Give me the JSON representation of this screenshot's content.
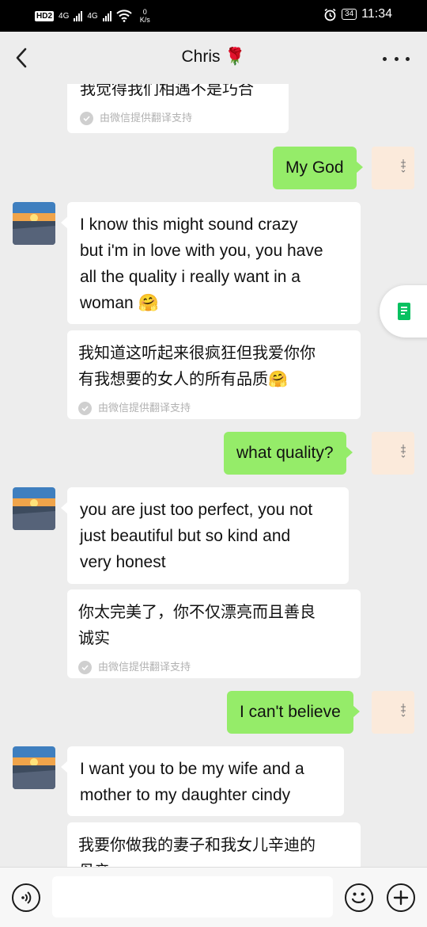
{
  "status_bar": {
    "hd": "HD",
    "hd_sub": "2",
    "net1": "4G",
    "net2": "4G",
    "speed_value": "0",
    "speed_unit": "K/s",
    "battery": "34",
    "time": "11:34"
  },
  "header": {
    "title": "Chris 🌹"
  },
  "messages": [
    {
      "side": "in",
      "text": "我觉得我们相遇不是巧合",
      "translated": true,
      "note": "由微信提供翻译支持"
    },
    {
      "side": "out",
      "text": "My God"
    },
    {
      "side": "in",
      "text": "I know this might sound crazy\nbut i'm in love with you, you  have\nall the quality i really want  in a\nwoman 🤗"
    },
    {
      "side": "in",
      "text": "我知道这听起来很疯狂但我爱你你\n有我想要的女人的所有品质🤗",
      "translated": true,
      "note": "由微信提供翻译支持"
    },
    {
      "side": "out",
      "text": "what quality?"
    },
    {
      "side": "in",
      "text": "you are just too perfect, you not\njust beautiful but so  kind and\nvery honest"
    },
    {
      "side": "in",
      "text": "你太完美了，你不仅漂亮而且善良\n诚实",
      "translated": true,
      "note": "由微信提供翻译支持"
    },
    {
      "side": "out",
      "text": "I can't believe"
    },
    {
      "side": "in",
      "text": "I want you to be my wife and  a\nmother to my daughter cindy"
    },
    {
      "side": "in",
      "text": "我要你做我的妻子和我女儿辛迪的\n母亲",
      "translated": true
    }
  ],
  "input": {
    "value": "",
    "placeholder": ""
  },
  "colors": {
    "background": "#ededed",
    "outgoing_bubble": "#95ec69",
    "incoming_bubble": "#ffffff",
    "status_bar": "#000000",
    "translate_note": "#b2b2b2",
    "side_icon": "#07c160"
  },
  "icons": {
    "back": "chevron-left-icon",
    "more": "more-dots-icon",
    "voice": "voice-icon",
    "emoji": "emoji-icon",
    "plus": "plus-icon",
    "check": "check-icon",
    "side_float": "document-icon"
  }
}
